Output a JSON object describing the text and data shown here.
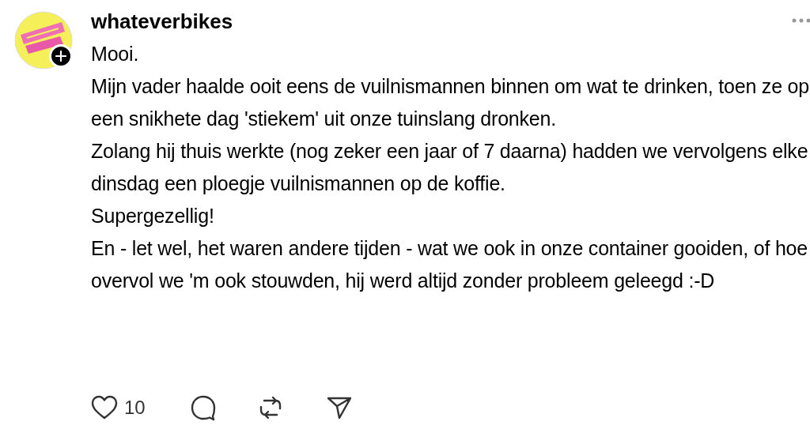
{
  "post": {
    "author": "whateverbikes",
    "paragraphs": [
      "Mooi.",
      "Mijn vader haalde ooit eens de vuilnismannen binnen om wat te drinken, toen ze op een snikhete dag 'stiekem' uit onze tuinslang dronken.",
      "Zolang hij thuis werkte (nog zeker een jaar of 7 daarna) hadden we vervolgens elke dinsdag een ploegje vuilnismannen op de koffie.",
      "Supergezellig!",
      "En - let wel, het waren andere tijden - wat we ook in onze container gooiden, of hoe overvol we 'm ook stouwden, hij werd altijd zonder probleem geleegd :-D"
    ],
    "like_count": "10"
  }
}
